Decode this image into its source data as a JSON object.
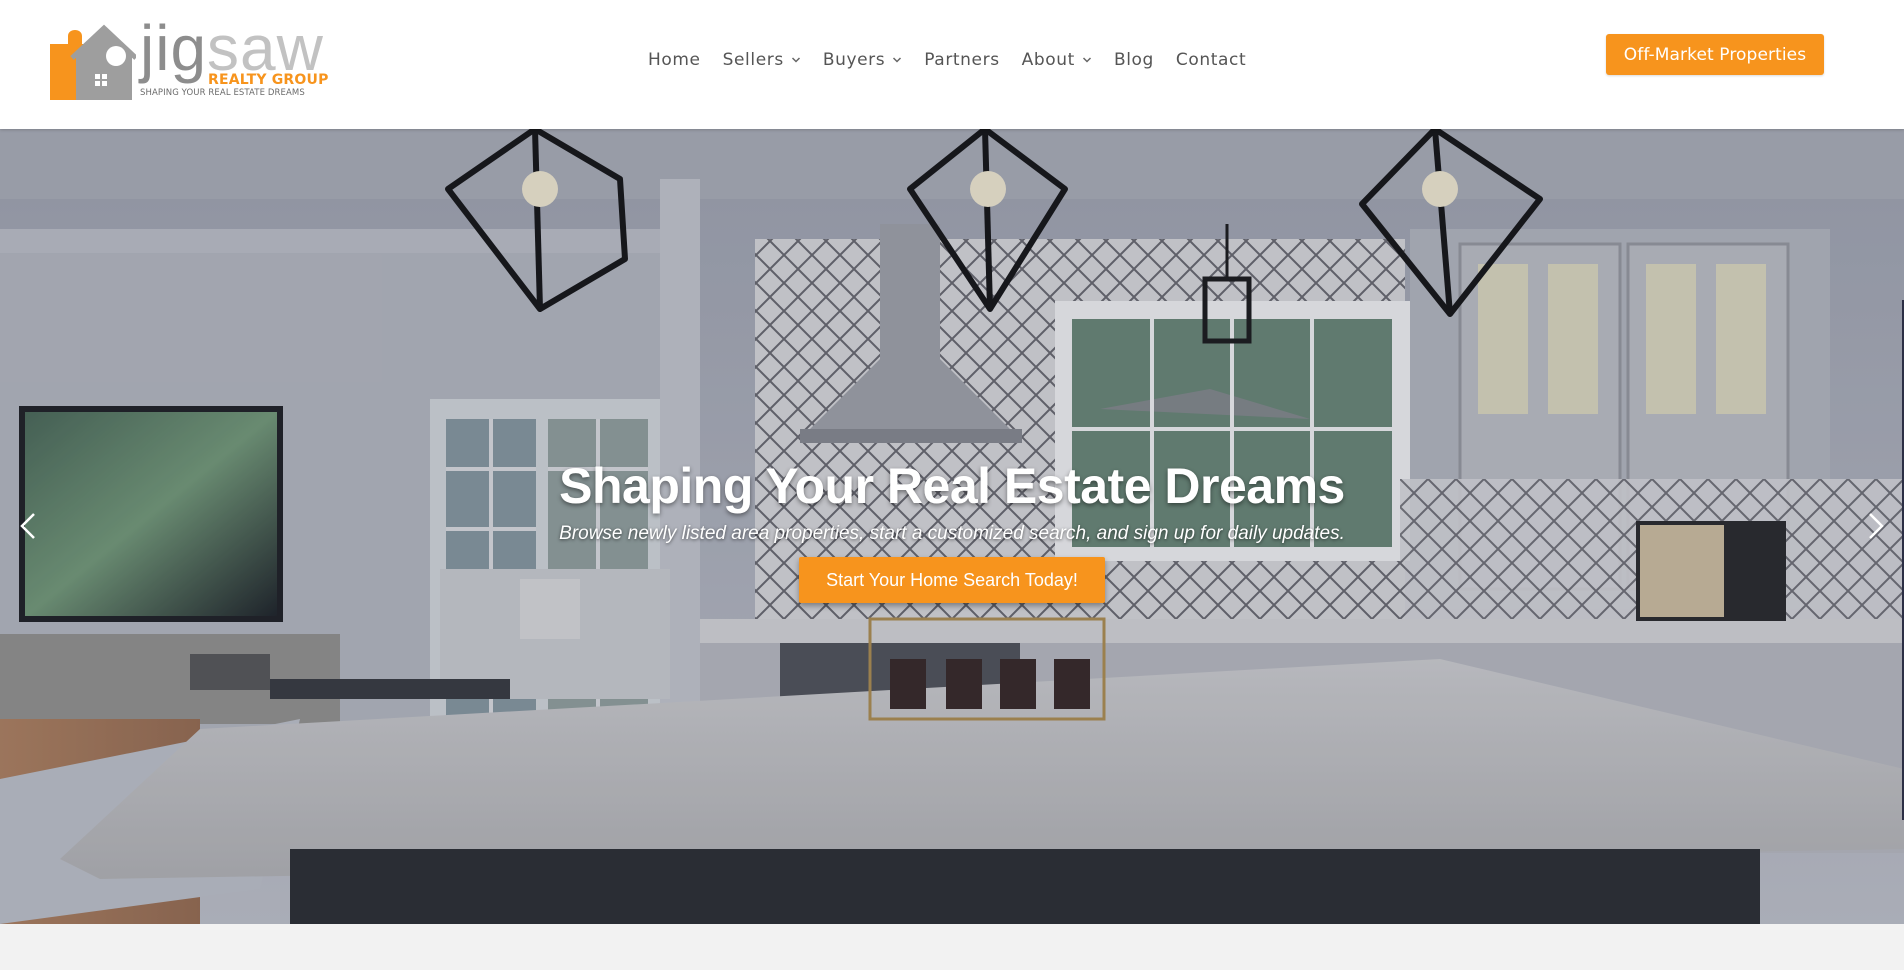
{
  "brand": {
    "word_dark": "jig",
    "word_light": "saw",
    "sub": "REALTY GROUP",
    "tagline": "SHAPING YOUR REAL ESTATE DREAMS",
    "colors": {
      "accent": "#f7941d",
      "gray": "#9e9e9e"
    }
  },
  "nav": {
    "items": [
      {
        "label": "Home",
        "has_dropdown": false
      },
      {
        "label": "Sellers",
        "has_dropdown": true
      },
      {
        "label": "Buyers",
        "has_dropdown": true
      },
      {
        "label": "Partners",
        "has_dropdown": false
      },
      {
        "label": "About",
        "has_dropdown": true
      },
      {
        "label": "Blog",
        "has_dropdown": false
      },
      {
        "label": "Contact",
        "has_dropdown": false
      }
    ],
    "dropdown_icon": "chevron-down-icon"
  },
  "header": {
    "cta_label": "Off-Market Properties"
  },
  "hero": {
    "title": "Shaping Your Real Estate Dreams",
    "subtitle": "Browse newly listed area properties, start a customized search, and sign up for daily updates.",
    "cta_label": "Start Your Home Search Today!",
    "prev_icon": "chevron-left-icon",
    "next_icon": "chevron-right-icon",
    "image_subject": "kitchen-interior-photo"
  }
}
